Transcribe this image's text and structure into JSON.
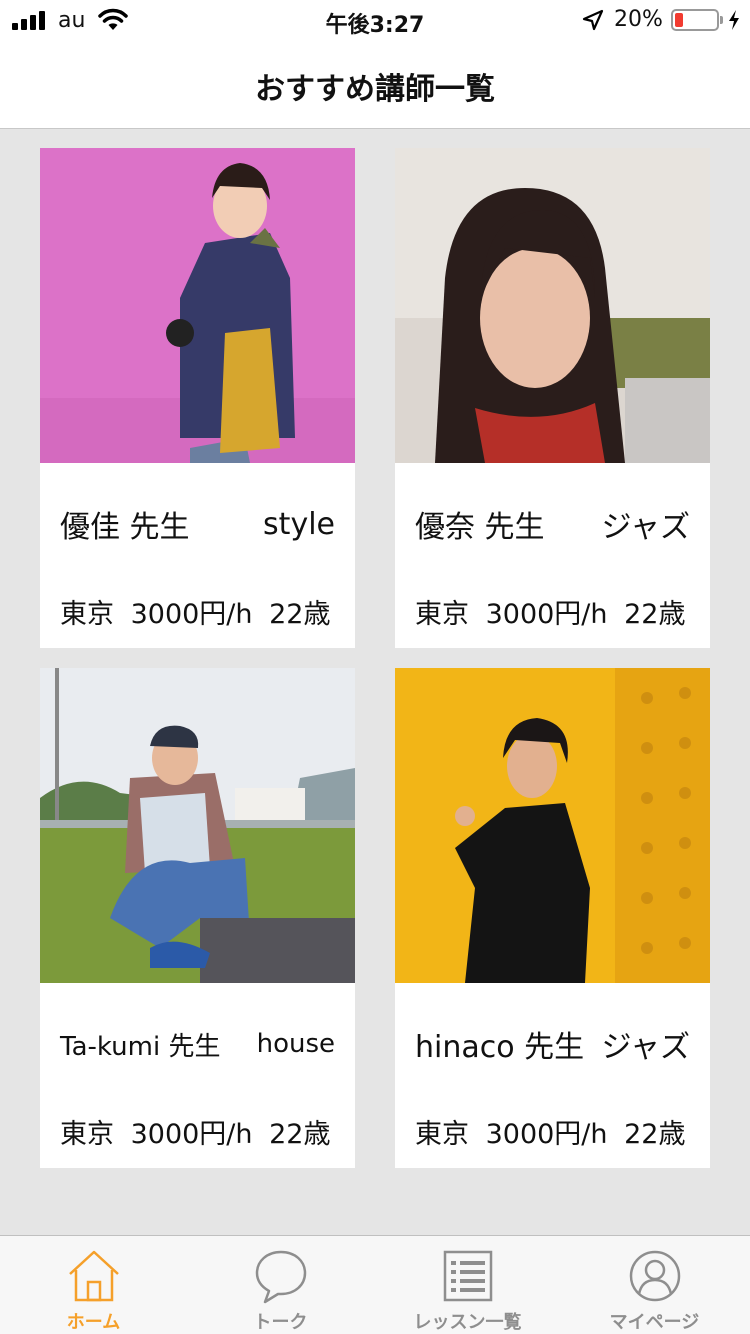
{
  "status_bar": {
    "carrier": "au",
    "time": "午後3:27",
    "battery_percent": "20%",
    "battery_level": 0.2
  },
  "header": {
    "title": "おすすめ講師一覧"
  },
  "teachers": [
    {
      "name": "優佳 先生",
      "genre": "style",
      "location": "東京",
      "price": "3000円/h",
      "age": "22歳"
    },
    {
      "name": "優奈 先生",
      "genre": "ジャズ",
      "location": "東京",
      "price": "3000円/h",
      "age": "22歳"
    },
    {
      "name": "Ta-kumi 先生",
      "genre": "house",
      "location": "東京",
      "price": "3000円/h",
      "age": "22歳"
    },
    {
      "name": "hinaco 先生",
      "genre": "ジャズ",
      "location": "東京",
      "price": "3000円/h",
      "age": "22歳"
    }
  ],
  "tabbar": {
    "active": "home",
    "items": [
      {
        "id": "home",
        "label": "ホーム",
        "icon": "home-icon"
      },
      {
        "id": "talk",
        "label": "トーク",
        "icon": "chat-bubble-icon"
      },
      {
        "id": "lessons",
        "label": "レッスン一覧",
        "icon": "list-icon"
      },
      {
        "id": "mypage",
        "label": "マイページ",
        "icon": "user-icon"
      }
    ]
  },
  "colors": {
    "accent": "#f5a02a",
    "inactive": "#8e8e8e",
    "background": "#e5e5e5"
  }
}
